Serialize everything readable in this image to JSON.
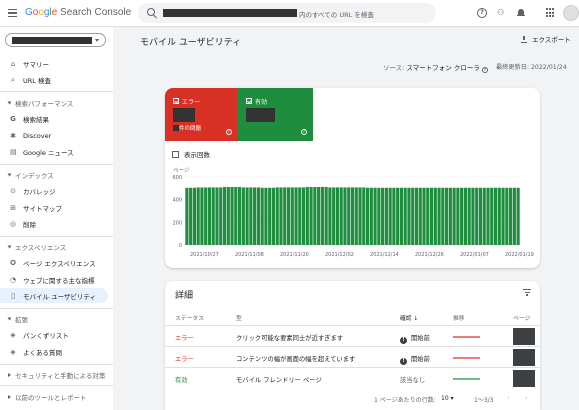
{
  "header": {
    "logo_google": "Google",
    "logo_product": "Search Console",
    "search_placeholder_suffix": "内のすべての URL を検査"
  },
  "sidebar": {
    "items_top": [
      {
        "label": "サマリー",
        "icon": "home-icon"
      },
      {
        "label": "URL 検査",
        "icon": "search-icon"
      }
    ],
    "sections": [
      {
        "title": "検索パフォーマンス",
        "items": [
          {
            "label": "検索結果",
            "icon": "google-g-icon"
          },
          {
            "label": "Discover",
            "icon": "asterisk-icon"
          },
          {
            "label": "Google ニュース",
            "icon": "news-icon"
          }
        ]
      },
      {
        "title": "インデックス",
        "items": [
          {
            "label": "カバレッジ",
            "icon": "coverage-icon"
          },
          {
            "label": "サイトマップ",
            "icon": "sitemap-icon"
          },
          {
            "label": "削除",
            "icon": "visibility-off-icon"
          }
        ]
      },
      {
        "title": "エクスペリエンス",
        "items": [
          {
            "label": "ページ エクスペリエンス",
            "icon": "page-experience-icon"
          },
          {
            "label": "ウェブに関する主な指標",
            "icon": "speed-icon"
          },
          {
            "label": "モバイル ユーザビリティ",
            "icon": "smartphone-icon",
            "active": true
          }
        ]
      },
      {
        "title": "拡張",
        "items": [
          {
            "label": "パンくずリスト",
            "icon": "diamond-icon"
          },
          {
            "label": "よくある質問",
            "icon": "diamond-icon"
          }
        ]
      }
    ],
    "collapsed_sections": [
      "セキュリティと手動による対策",
      "以前のツールとレポート"
    ]
  },
  "main": {
    "title": "モバイル ユーザビリティ",
    "export_label": "エクスポート",
    "source_label": "ソース:",
    "source_value": "スマートフォン クローラ",
    "last_updated": "最終更新日: 2022/01/24",
    "tiles": {
      "error_label": "エラー",
      "error_sub": "件の問題",
      "valid_label": "有効"
    },
    "show_count_label": "表示回数"
  },
  "chart_data": {
    "type": "bar",
    "ylabel": "ページ",
    "yticks": [
      0,
      200,
      400,
      600
    ],
    "ylim": [
      0,
      600
    ],
    "xtick_labels": [
      "2021/10/27",
      "2021/11/08",
      "2021/11/20",
      "2021/12/02",
      "2021/12/14",
      "2021/12/26",
      "2022/01/07",
      "2022/01/19"
    ],
    "bar_color": "#1e8e3e",
    "series": [
      {
        "values": [
          505,
          505,
          505,
          508,
          508,
          508,
          508,
          508,
          508,
          508,
          512,
          512,
          512,
          512,
          512,
          508,
          508,
          508,
          508,
          508,
          505,
          505,
          505,
          505,
          508,
          508,
          508,
          508,
          508,
          508,
          508,
          508,
          512,
          512,
          512,
          512,
          512,
          512,
          508,
          508,
          508,
          508,
          508,
          508,
          508,
          508,
          508,
          508,
          505,
          505,
          505,
          505,
          505,
          505,
          505,
          505,
          505,
          505,
          505,
          505,
          505,
          505,
          505,
          505,
          505,
          505,
          505,
          505,
          505,
          505,
          505,
          505,
          505,
          505,
          505,
          505,
          505,
          505,
          505,
          505,
          505,
          505,
          505,
          505,
          505,
          505,
          505,
          505,
          505
        ]
      }
    ]
  },
  "details": {
    "title": "詳細",
    "columns": [
      "ステータス",
      "型",
      "確認",
      "推移",
      "ページ"
    ],
    "rows": [
      {
        "status": "エラー",
        "status_kind": "error",
        "type": "クリック可能な要素同士が近すぎます",
        "validation": "開始前",
        "trend_color": "#d93025"
      },
      {
        "status": "エラー",
        "status_kind": "error",
        "type": "コンテンツの幅が画面の幅を超えています",
        "validation": "開始前",
        "trend_color": "#d93025"
      },
      {
        "status": "有効",
        "status_kind": "valid",
        "type": "モバイル フレンドリー ページ",
        "validation": "該当なし",
        "trend_color": "#1e8e3e"
      }
    ],
    "footer": {
      "rows_per_page_label": "1 ページあたりの行数:",
      "rows_per_page": "10",
      "range": "1〜3/3"
    }
  }
}
